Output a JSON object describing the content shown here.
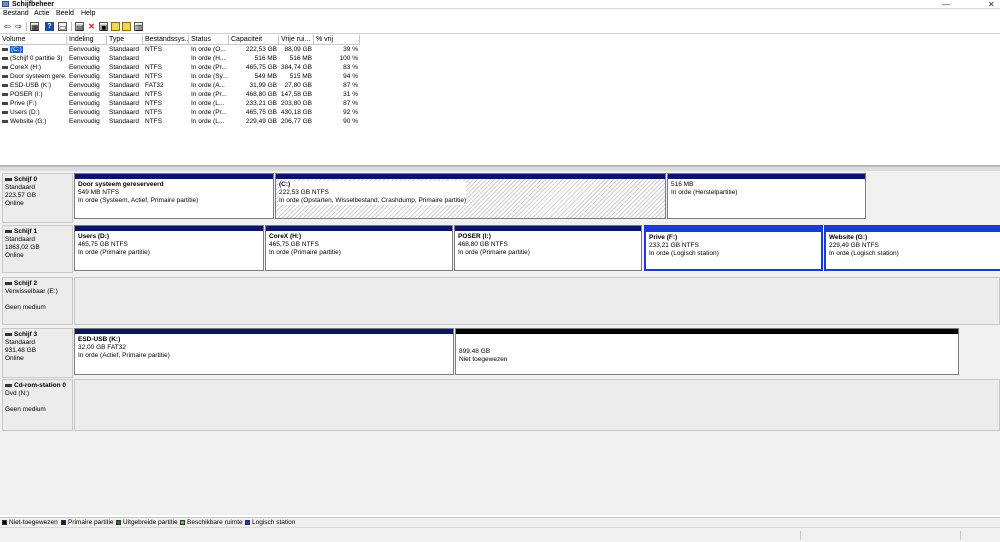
{
  "window": {
    "title": "Schijfbeheer",
    "minimize": "—",
    "close": "✕"
  },
  "menu": [
    "Bestand",
    "Actie",
    "Beeld",
    "Help"
  ],
  "toolbar": {
    "icons": [
      "back-arrow-icon",
      "forward-arrow-icon",
      "properties-icon",
      "help-icon",
      "disk-icon",
      "delete-icon",
      "new-volume-icon",
      "open-icon",
      "grid-icon"
    ],
    "glyphs": [
      "⇦",
      "⇨",
      "▦",
      "?",
      "▭",
      "✕",
      "▤",
      "▣",
      "▥"
    ]
  },
  "volume_table": {
    "columns": [
      "Volume",
      "Indeling",
      "Type",
      "Bestandssys...",
      "Status",
      "Capaciteit",
      "Vrije rui...",
      "% vrij"
    ],
    "rows": [
      [
        "(C:)",
        "Eenvoudig",
        "Standaard",
        "NTFS",
        "In orde (O...",
        "222,53 GB",
        "88,09 GB",
        "39 %"
      ],
      [
        "(Schijf 0 partitie 3)",
        "Eenvoudig",
        "Standaard",
        "",
        "In orde (H...",
        "516 MB",
        "516 MB",
        "100 %"
      ],
      [
        "CoreX (H:)",
        "Eenvoudig",
        "Standaard",
        "NTFS",
        "In orde (Pr...",
        "465,75 GB",
        "384,74 GB",
        "83 %"
      ],
      [
        "Door systeem gere...",
        "Eenvoudig",
        "Standaard",
        "NTFS",
        "In orde (Sy...",
        "549 MB",
        "515 MB",
        "94 %"
      ],
      [
        "ESD-USB (K:)",
        "Eenvoudig",
        "Standaard",
        "FAT32",
        "In orde (A...",
        "31,99 GB",
        "27,80 GB",
        "87 %"
      ],
      [
        "POSER (I:)",
        "Eenvoudig",
        "Standaard",
        "NTFS",
        "In orde (Pr...",
        "468,80 GB",
        "147,58 GB",
        "31 %"
      ],
      [
        "Prive (F:)",
        "Eenvoudig",
        "Standaard",
        "NTFS",
        "In orde (L...",
        "233,21 GB",
        "203,80 GB",
        "87 %"
      ],
      [
        "Users (D:)",
        "Eenvoudig",
        "Standaard",
        "NTFS",
        "In orde (Pr...",
        "465,75 GB",
        "430,18 GB",
        "92 %"
      ],
      [
        "Website (G:)",
        "Eenvoudig",
        "Standaard",
        "NTFS",
        "In orde (L...",
        "229,49 GB",
        "206,77 GB",
        "90 %"
      ]
    ]
  },
  "disks": [
    {
      "name": "Schijf 0",
      "lines": [
        "Standaard",
        "223,57 GB",
        "Online"
      ],
      "partitions": [
        {
          "name": "Door systeem gereserveerd",
          "size": "549 MB NTFS",
          "status": "In orde (Systeem, Actief, Primaire partitie)",
          "color": "#0a1464",
          "hatched": false
        },
        {
          "name": "(C:)",
          "size": "222,53 GB NTFS",
          "status": "In orde (Opstarten, Wisselbestand, Crashdump, Primaire partitie)",
          "color": "#0a1464",
          "hatched": true
        },
        {
          "name": "",
          "size": "516 MB",
          "status": "In orde (Herstelpartitie)",
          "color": "#0a1464",
          "hatched": false
        }
      ]
    },
    {
      "name": "Schijf 1",
      "lines": [
        "Standaard",
        "1863,02 GB",
        "Online"
      ],
      "partitions": [
        {
          "name": "Users  (D:)",
          "size": "465,75 GB NTFS",
          "status": "In orde (Primaire partitie)",
          "color": "#0a1464"
        },
        {
          "name": "CoreX  (H:)",
          "size": "465,75 GB NTFS",
          "status": "In orde (Primaire partitie)",
          "color": "#0a1464"
        },
        {
          "name": "POSER  (I:)",
          "size": "468,80 GB NTFS",
          "status": "In orde (Primaire partitie)",
          "color": "#0a1464"
        },
        {
          "name": "Prive  (F:)",
          "size": "233,21 GB NTFS",
          "status": "In orde (Logisch station)",
          "color": "#1a3ad6"
        },
        {
          "name": "Website  (G:)",
          "size": "229,49 GB NTFS",
          "status": "In orde (Logisch station)",
          "color": "#1a3ad6"
        }
      ]
    },
    {
      "name": "Schijf 2",
      "lines": [
        "Verwisselbaar (E:)",
        "",
        "Geen medium"
      ],
      "partitions": []
    },
    {
      "name": "Schijf 3",
      "lines": [
        "Standaard",
        "931,48 GB",
        "Online"
      ],
      "partitions": [
        {
          "name": "ESD-USB  (K:)",
          "size": "32,00 GB FAT32",
          "status": "In orde (Actief, Primaire partitie)",
          "color": "#0a1464"
        },
        {
          "name": "",
          "size": "899,48 GB",
          "status": "Niet toegewezen",
          "color": "#000000"
        }
      ]
    },
    {
      "name": "Cd-rom-station 0",
      "lines": [
        "Dvd (N:)",
        "",
        "Geen medium"
      ],
      "partitions": []
    }
  ],
  "legend": [
    {
      "label": "Niet-toegewezen",
      "color": "#000000"
    },
    {
      "label": "Primaire partitie",
      "color": "#0a1464"
    },
    {
      "label": "Uitgebreide partitie",
      "color": "#1f7a1f"
    },
    {
      "label": "Beschikbare ruimte",
      "color": "#3ad63a"
    },
    {
      "label": "Logisch station",
      "color": "#1a3ad6"
    }
  ]
}
